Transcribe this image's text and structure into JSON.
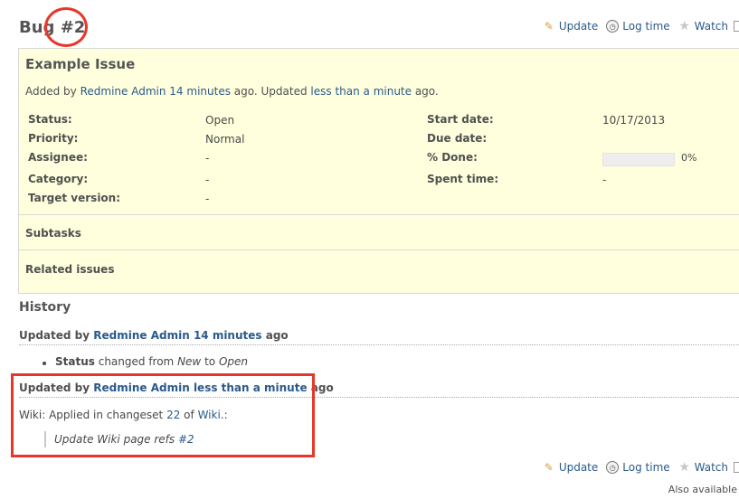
{
  "header": {
    "tracker": "Bug",
    "issue_number": "#2"
  },
  "actions": {
    "update": "Update",
    "log_time": "Log time",
    "watch": "Watch"
  },
  "issue": {
    "subject": "Example Issue",
    "added_by_prefix": "Added by ",
    "author": "Redmine Admin",
    "added_ago": "14 minutes",
    "updated_mid": " ago. Updated ",
    "updated_ago": "less than a minute",
    "updated_suffix": " ago.",
    "attributes": {
      "status_label": "Status:",
      "status_value": "Open",
      "priority_label": "Priority:",
      "priority_value": "Normal",
      "assignee_label": "Assignee:",
      "assignee_value": "-",
      "category_label": "Category:",
      "category_value": "-",
      "target_version_label": "Target version:",
      "target_version_value": "-",
      "start_date_label": "Start date:",
      "start_date_value": "10/17/2013",
      "due_date_label": "Due date:",
      "due_date_value": "",
      "done_label": "% Done:",
      "done_value": "0%",
      "done_fraction": 0,
      "spent_time_label": "Spent time:",
      "spent_time_value": "-"
    },
    "subtasks_label": "Subtasks",
    "related_label": "Related issues"
  },
  "history": {
    "title": "History",
    "journals": [
      {
        "prefix": "Updated by ",
        "author": "Redmine Admin",
        "space": " ",
        "ago": "14 minutes",
        "suffix": " ago",
        "detail_field": "Status",
        "detail_mid": " changed from ",
        "detail_old": "New",
        "detail_to": " to ",
        "detail_new": "Open"
      },
      {
        "prefix": "Updated by ",
        "author": "Redmine Admin",
        "space": " ",
        "ago": "less than a minute",
        "suffix": " ago",
        "notes_prefix": "Wiki: Applied in changeset ",
        "notes_changeset": "22",
        "notes_of": " of ",
        "notes_repo": "Wiki",
        "notes_end": ".:",
        "quote_text": "Update Wiki page refs ",
        "quote_ref": "#2"
      }
    ]
  },
  "footer": {
    "also_available": "Also available"
  },
  "colors": {
    "link": "#2a5a8a",
    "issue_background": "#ffffdd",
    "annotation_red": "#e8372a"
  }
}
